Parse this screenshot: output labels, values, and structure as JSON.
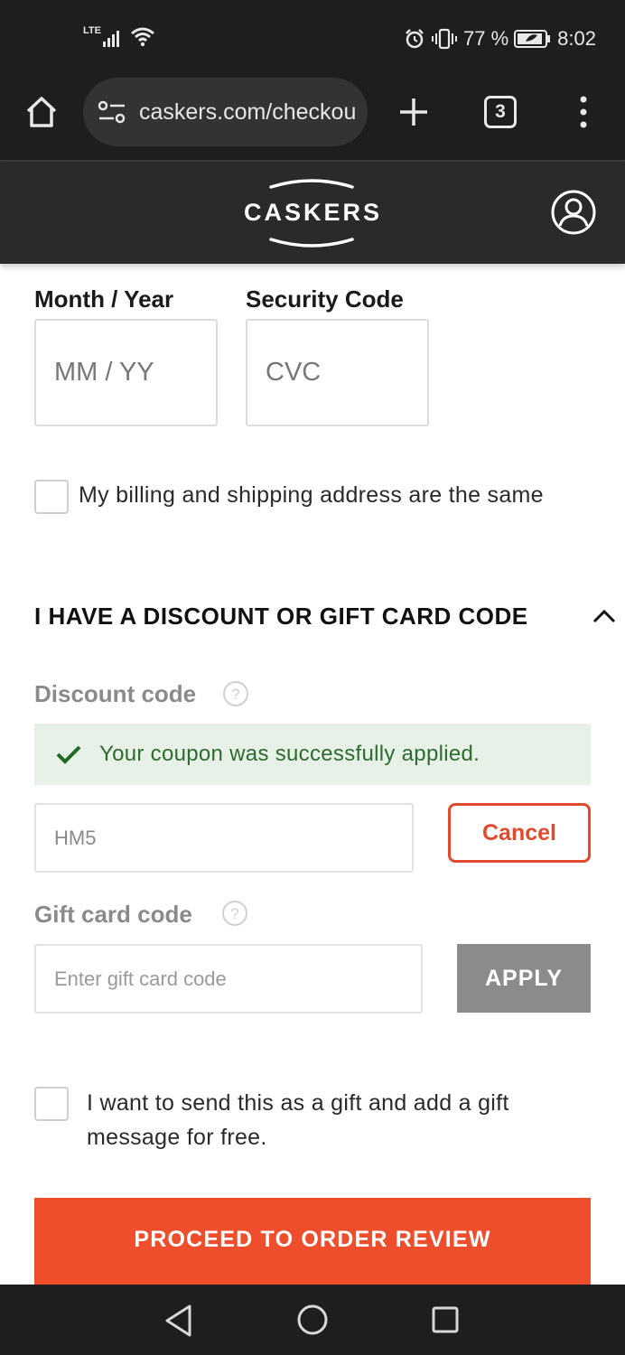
{
  "status_bar": {
    "network": "LTE",
    "battery": "77 %",
    "time": "8:02"
  },
  "browser": {
    "url": "caskers.com/checkout",
    "tab_count": "3"
  },
  "site": {
    "logo": "CASKERS"
  },
  "payment": {
    "expiry_label": "Month / Year",
    "expiry_placeholder": "MM / YY",
    "cvc_label": "Security Code",
    "cvc_placeholder": "CVC",
    "same_address_label": "My billing and shipping address are the same"
  },
  "discount_section": {
    "title": "I HAVE A DISCOUNT OR GIFT CARD CODE",
    "discount_label": "Discount code",
    "success_message": "Your coupon was successfully applied.",
    "discount_value": "HM5",
    "cancel_label": "Cancel",
    "gift_card_label": "Gift card code",
    "gift_card_placeholder": "Enter gift card code",
    "apply_label": "APPLY"
  },
  "gift": {
    "label": "I want to send this as a gift and add a gift message for free."
  },
  "actions": {
    "proceed_label": "PROCEED TO ORDER REVIEW"
  },
  "colors": {
    "accent": "#ee4e2c",
    "success_bg": "#e7f1e7",
    "success_text": "#2e6b2e",
    "header_bg": "#2a2a2a"
  },
  "icons": {
    "status": [
      "lte-signal-icon",
      "wifi-icon",
      "alarm-icon",
      "vibrate-icon",
      "battery-icon"
    ],
    "browser": [
      "home-icon",
      "site-settings-icon",
      "new-tab-icon",
      "tabs-icon",
      "more-menu-icon"
    ],
    "nav": [
      "back-icon",
      "home-circle-icon",
      "recents-icon"
    ]
  }
}
